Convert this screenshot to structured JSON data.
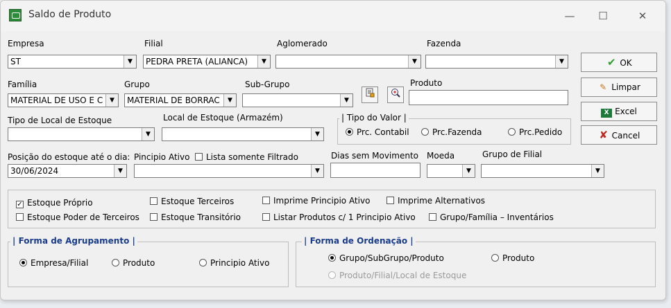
{
  "window": {
    "title": "Saldo de Produto",
    "minimize": "—",
    "maximize": "☐",
    "close": "✕"
  },
  "labels": {
    "empresa": "Empresa",
    "filial": "Filial",
    "aglomerado": "Aglomerado",
    "fazenda": "Fazenda",
    "familia": "Família",
    "grupo": "Grupo",
    "subgrupo": "Sub-Grupo",
    "produto": "Produto",
    "tipo_local": "Tipo de Local de Estoque",
    "local_estoque": "Local de Estoque (Armazém)",
    "posicao": "Posição do estoque até o dia:",
    "principio_ativo": "Pincipio Ativo",
    "lista_filtrado": "Lista somente Filtrado",
    "dias_sem_mov": "Dias sem Movimento",
    "moeda": "Moeda",
    "grupo_filial": "Grupo de Filial"
  },
  "fields": {
    "empresa": "ST",
    "filial": "PEDRA PRETA (ALIANCA)",
    "aglomerado": "",
    "fazenda": "",
    "familia": "MATERIAL DE USO E C",
    "grupo": "MATERIAL DE BORRAC",
    "subgrupo": "",
    "produto": "",
    "tipo_local": "",
    "local_estoque": "",
    "posicao": "30/06/2024",
    "principio_ativo": "",
    "dias_sem_mov": "",
    "moeda": "",
    "grupo_filial": ""
  },
  "tipo_valor": {
    "title": "Tipo do Valor",
    "options": [
      "Prc. Contabil",
      "Prc.Fazenda",
      "Prc.Pedido"
    ],
    "selected": 0
  },
  "buttons": {
    "ok": "OK",
    "limpar": "Limpar",
    "excel": "Excel",
    "cancel": "Cancel"
  },
  "checkboxes": {
    "estoque_proprio": "Estoque Próprio",
    "estoque_terceiros": "Estoque Terceiros",
    "imprime_principio": "Imprime Principio Ativo",
    "imprime_alternativos": "Imprime Alternativos",
    "estoque_poder_terceiros": "Estoque Poder de Terceiros",
    "estoque_transitorio": "Estoque Transitório",
    "listar_produtos": "Listar Produtos c/ 1 Principio Ativo",
    "grupo_familia": "Grupo/Família – Inventários",
    "checked": [
      "estoque_proprio"
    ]
  },
  "agrupamento": {
    "title": "Forma de Agrupamento",
    "options": [
      "Empresa/Filial",
      "Produto",
      "Principio Ativo"
    ],
    "selected": 0
  },
  "ordenacao": {
    "title": "Forma de Ordenação",
    "options": [
      "Grupo/SubGrupo/Produto",
      "Produto",
      "Produto/Filial/Local de Estoque"
    ],
    "selected": 0,
    "disabled": [
      2
    ]
  },
  "colors": {
    "accent_title": "#1a3c8c",
    "ok_check": "#2e9e2e",
    "cancel_x": "#c0281e",
    "excel": "#1d7a3a"
  },
  "icons": {
    "app": "app-icon",
    "ok": "check-icon",
    "limpar": "eraser-icon",
    "excel": "excel-icon",
    "cancel": "x-icon",
    "search_product": "product-lookup-icon",
    "zoom": "magnifier-icon"
  }
}
